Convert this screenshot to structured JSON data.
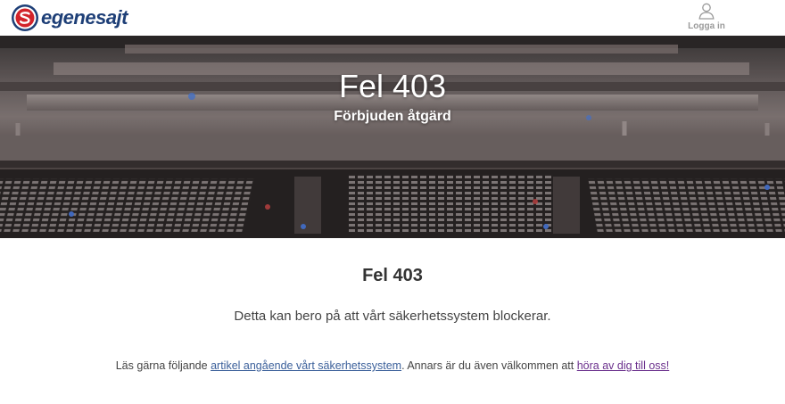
{
  "header": {
    "logo_text": "egenesajt",
    "login_label": "Logga in"
  },
  "hero": {
    "title": "Fel 403",
    "subtitle": "Förbjuden åtgärd"
  },
  "main": {
    "title": "Fel 403",
    "description": "Detta kan bero på att vårt säkerhetssystem blockerar.",
    "links_sentence": {
      "prefix": "Läs gärna följande ",
      "link1_text": "artikel angående vårt säkerhetssystem",
      "middle": ". Annars är du även välkommen att ",
      "link2_text": "höra av dig till oss!"
    }
  },
  "colors": {
    "brand_blue": "#1e3f77",
    "brand_red": "#d2232a",
    "link": "#3a5f9a",
    "visited_link": "#6a2f8c"
  }
}
